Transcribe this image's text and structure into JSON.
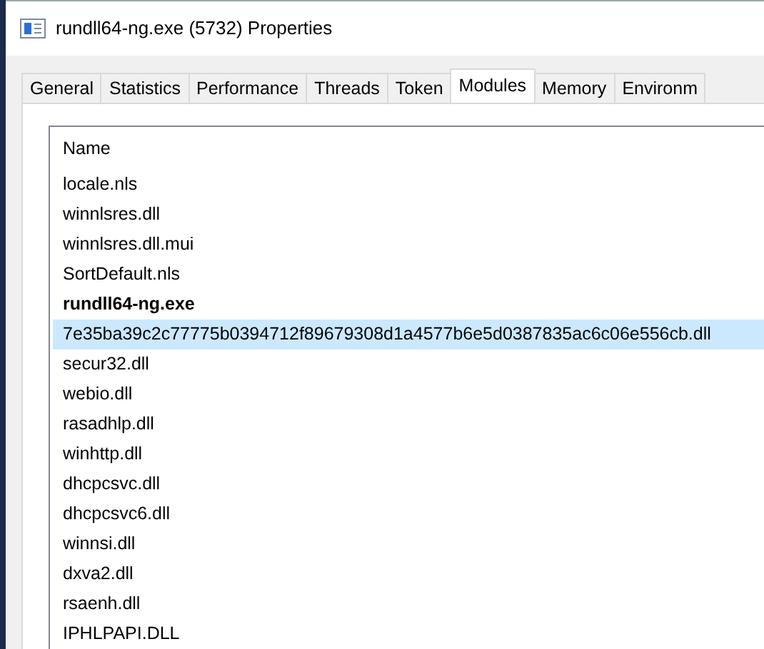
{
  "window": {
    "title": "rundll64-ng.exe (5732) Properties"
  },
  "tabs": [
    {
      "label": "General",
      "selected": false
    },
    {
      "label": "Statistics",
      "selected": false
    },
    {
      "label": "Performance",
      "selected": false
    },
    {
      "label": "Threads",
      "selected": false
    },
    {
      "label": "Token",
      "selected": false
    },
    {
      "label": "Modules",
      "selected": true
    },
    {
      "label": "Memory",
      "selected": false
    },
    {
      "label": "Environm",
      "selected": false
    }
  ],
  "modules": {
    "columns": [
      "Name"
    ],
    "rows": [
      {
        "name": "locale.nls",
        "bold": false,
        "selected": false
      },
      {
        "name": "winnlsres.dll",
        "bold": false,
        "selected": false
      },
      {
        "name": "winnlsres.dll.mui",
        "bold": false,
        "selected": false
      },
      {
        "name": "SortDefault.nls",
        "bold": false,
        "selected": false
      },
      {
        "name": "rundll64-ng.exe",
        "bold": true,
        "selected": false
      },
      {
        "name": "7e35ba39c2c77775b0394712f89679308d1a4577b6e5d0387835ac6c06e556cb.dll",
        "bold": false,
        "selected": true
      },
      {
        "name": "secur32.dll",
        "bold": false,
        "selected": false
      },
      {
        "name": "webio.dll",
        "bold": false,
        "selected": false
      },
      {
        "name": "rasadhlp.dll",
        "bold": false,
        "selected": false
      },
      {
        "name": "winhttp.dll",
        "bold": false,
        "selected": false
      },
      {
        "name": "dhcpcsvc.dll",
        "bold": false,
        "selected": false
      },
      {
        "name": "dhcpcsvc6.dll",
        "bold": false,
        "selected": false
      },
      {
        "name": "winnsi.dll",
        "bold": false,
        "selected": false
      },
      {
        "name": "dxva2.dll",
        "bold": false,
        "selected": false
      },
      {
        "name": "rsaenh.dll",
        "bold": false,
        "selected": false
      },
      {
        "name": "IPHLPAPI.DLL",
        "bold": false,
        "selected": false
      }
    ]
  }
}
